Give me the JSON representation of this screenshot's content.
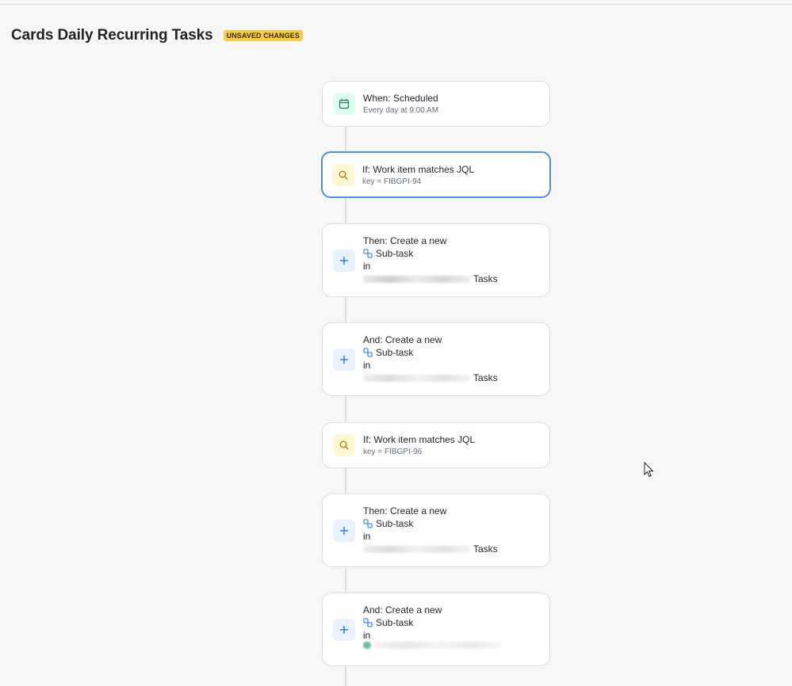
{
  "header": {
    "title": "Cards Daily Recurring Tasks",
    "badge": "UNSAVED CHANGES"
  },
  "cards": [
    {
      "label": "When: Scheduled",
      "detail": "Every day at 9:00 AM",
      "icon": "calendar-icon"
    },
    {
      "label": "If: Work item matches JQL",
      "detail": "key = FIBGPI-94",
      "icon": "search-icon"
    },
    {
      "label": "Then: Create a new",
      "issue_type": "Sub-task",
      "in_label": "in",
      "project_suffix": "Tasks",
      "icon": "plus-icon"
    },
    {
      "label": "And: Create a new",
      "issue_type": "Sub-task",
      "in_label": "in",
      "project_suffix": "Tasks",
      "icon": "plus-icon"
    },
    {
      "label": "If: Work item matches JQL",
      "detail": "key = FIBGPI-96",
      "icon": "search-icon"
    },
    {
      "label": "Then: Create a new",
      "issue_type": "Sub-task",
      "in_label": "in",
      "project_suffix": "Tasks",
      "icon": "plus-icon"
    },
    {
      "label": "And: Create a new",
      "issue_type": "Sub-task",
      "in_label": "in",
      "project_suffix": "",
      "icon": "plus-icon"
    }
  ],
  "colors": {
    "badge": "#f5cd47",
    "selected_border": "#4a90e2",
    "trigger_icon_bg": "#dcfff1",
    "condition_icon_bg": "#fff7d6",
    "action_icon_bg": "#e9f2ff"
  }
}
